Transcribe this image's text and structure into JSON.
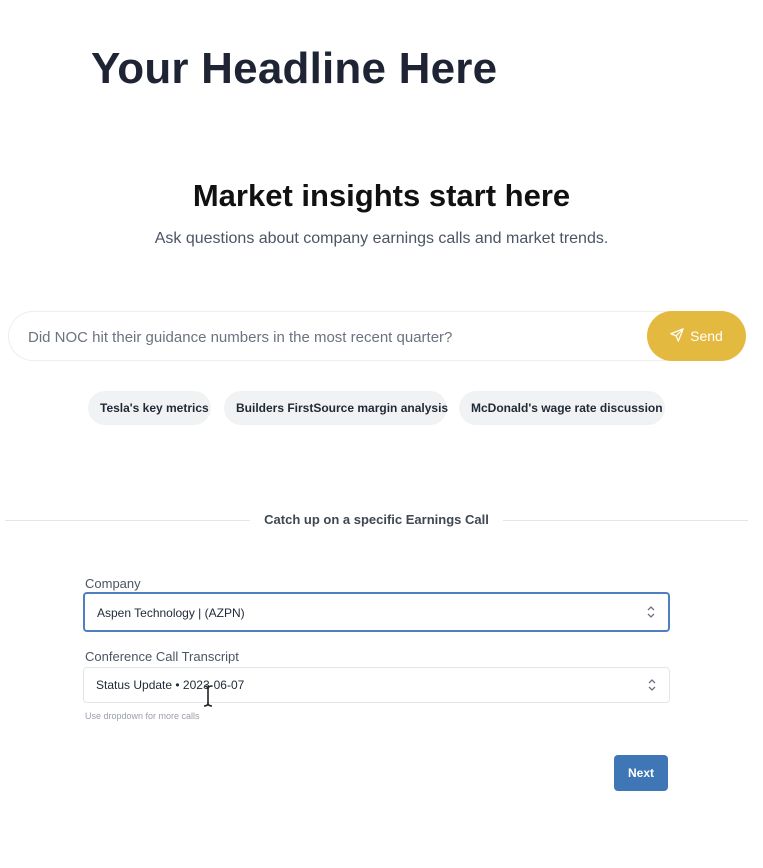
{
  "page": {
    "headline": "Your Headline Here"
  },
  "hero": {
    "title": "Market insights start here",
    "subtitle": "Ask questions about company earnings calls and market trends."
  },
  "search": {
    "placeholder": "Did NOC hit their guidance numbers in the most recent quarter?",
    "send_label": "Send",
    "send_icon": "paper-plane-icon",
    "accent_color": "#e4b93f"
  },
  "suggestions": [
    "Tesla's key metrics",
    "Builders FirstSource margin analysis",
    "McDonald's wage rate discussion"
  ],
  "earnings_call": {
    "divider_label": "Catch up on a specific Earnings Call",
    "company_label": "Company",
    "company_value": "Aspen Technology | (AZPN)",
    "transcript_label": "Conference Call Transcript",
    "transcript_value": "Status Update • 2023-06-07",
    "hint": "Use dropdown for more calls",
    "next_label": "Next",
    "button_color": "#3f77b6"
  }
}
